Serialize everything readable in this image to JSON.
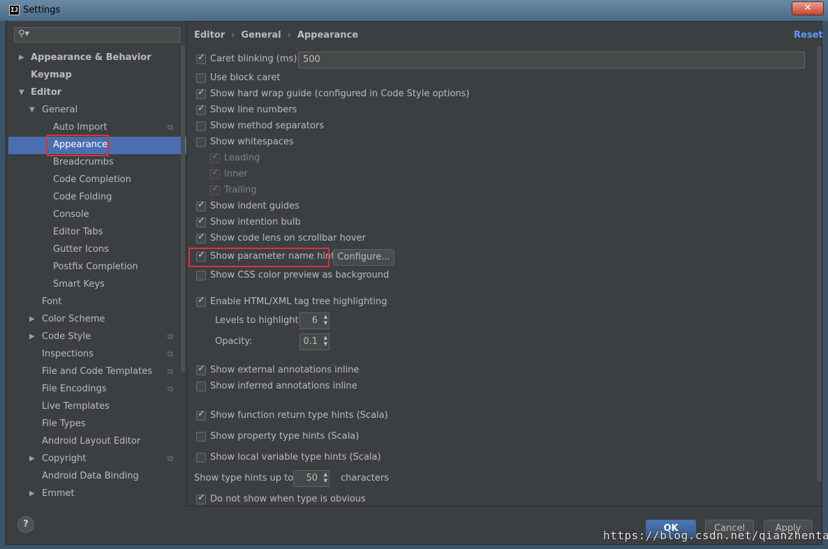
{
  "window": {
    "title": "Settings",
    "app_icon_text": "IJ",
    "close_symbol": "✕"
  },
  "search": {
    "placeholder": "",
    "icon": "search-icon"
  },
  "sidebar": {
    "items": [
      {
        "label": "Appearance & Behavior",
        "level": 0,
        "expandable": true,
        "expanded": false,
        "bold": true
      },
      {
        "label": "Keymap",
        "level": 0,
        "expandable": false,
        "bold": true
      },
      {
        "label": "Editor",
        "level": 0,
        "expandable": true,
        "expanded": true,
        "bold": true
      },
      {
        "label": "General",
        "level": 1,
        "expandable": true,
        "expanded": true
      },
      {
        "label": "Auto Import",
        "level": 2,
        "project_icon": true
      },
      {
        "label": "Appearance",
        "level": 2,
        "selected": true
      },
      {
        "label": "Breadcrumbs",
        "level": 2
      },
      {
        "label": "Code Completion",
        "level": 2
      },
      {
        "label": "Code Folding",
        "level": 2
      },
      {
        "label": "Console",
        "level": 2
      },
      {
        "label": "Editor Tabs",
        "level": 2
      },
      {
        "label": "Gutter Icons",
        "level": 2
      },
      {
        "label": "Postfix Completion",
        "level": 2
      },
      {
        "label": "Smart Keys",
        "level": 2
      },
      {
        "label": "Font",
        "level": 1
      },
      {
        "label": "Color Scheme",
        "level": 1,
        "expandable": true
      },
      {
        "label": "Code Style",
        "level": 1,
        "expandable": true,
        "project_icon": true
      },
      {
        "label": "Inspections",
        "level": 1,
        "project_icon": true
      },
      {
        "label": "File and Code Templates",
        "level": 1,
        "project_icon": true
      },
      {
        "label": "File Encodings",
        "level": 1,
        "project_icon": true
      },
      {
        "label": "Live Templates",
        "level": 1
      },
      {
        "label": "File Types",
        "level": 1
      },
      {
        "label": "Android Layout Editor",
        "level": 1
      },
      {
        "label": "Copyright",
        "level": 1,
        "expandable": true,
        "project_icon": true
      },
      {
        "label": "Android Data Binding",
        "level": 1
      },
      {
        "label": "Emmet",
        "level": 1,
        "expandable": true
      }
    ]
  },
  "breadcrumb": [
    "Editor",
    "General",
    "Appearance"
  ],
  "breadcrumb_sep": "›",
  "reset_label": "Reset",
  "options": {
    "caret_blinking": {
      "label": "Caret blinking (ms):",
      "checked": true,
      "value": "500"
    },
    "block_caret": {
      "label": "Use block caret",
      "checked": false
    },
    "hard_wrap": {
      "label": "Show hard wrap guide (configured in Code Style options)",
      "checked": true
    },
    "line_numbers": {
      "label": "Show line numbers",
      "checked": true
    },
    "method_separators": {
      "label": "Show method separators",
      "checked": false
    },
    "whitespaces": {
      "label": "Show whitespaces",
      "checked": false
    },
    "leading": {
      "label": "Leading",
      "checked": true,
      "disabled": true
    },
    "inner": {
      "label": "Inner",
      "checked": true,
      "disabled": true
    },
    "trailing": {
      "label": "Trailing",
      "checked": true,
      "disabled": true
    },
    "indent_guides": {
      "label": "Show indent guides",
      "checked": true
    },
    "intention_bulb": {
      "label": "Show intention bulb",
      "checked": true
    },
    "code_lens": {
      "label": "Show code lens on scrollbar hover",
      "checked": true
    },
    "param_hints": {
      "label": "Show parameter name hints",
      "checked": true,
      "configure_label": "Configure..."
    },
    "css_color": {
      "label": "Show CSS color preview as background",
      "checked": false
    },
    "tag_tree": {
      "label": "Enable HTML/XML tag tree highlighting",
      "checked": true
    },
    "levels": {
      "label": "Levels to highlight:",
      "value": "6"
    },
    "opacity": {
      "label": "Opacity:",
      "value": "0.1"
    },
    "ext_annotations": {
      "label": "Show external annotations inline",
      "checked": true
    },
    "inferred_annotations": {
      "label": "Show inferred annotations inline",
      "checked": false
    },
    "func_return_hints": {
      "label": "Show function return type hints (Scala)",
      "checked": true
    },
    "property_hints": {
      "label": "Show property type hints (Scala)",
      "checked": false
    },
    "local_var_hints": {
      "label": "Show local variable type hints (Scala)",
      "checked": false
    },
    "type_hints_up_to": {
      "label": "Show type hints up to:",
      "value": "50",
      "suffix": "characters"
    },
    "not_obvious": {
      "label": "Do not show when type is obvious",
      "checked": true
    }
  },
  "buttons": {
    "help": "?",
    "ok": "OK",
    "cancel": "Cancel",
    "apply": "Apply"
  },
  "watermark": "https://blog.csdn.net/qianzhentaosg",
  "colors": {
    "accent": "#4b6eaf",
    "link": "#589df6",
    "highlight_box": "#e0303a"
  }
}
